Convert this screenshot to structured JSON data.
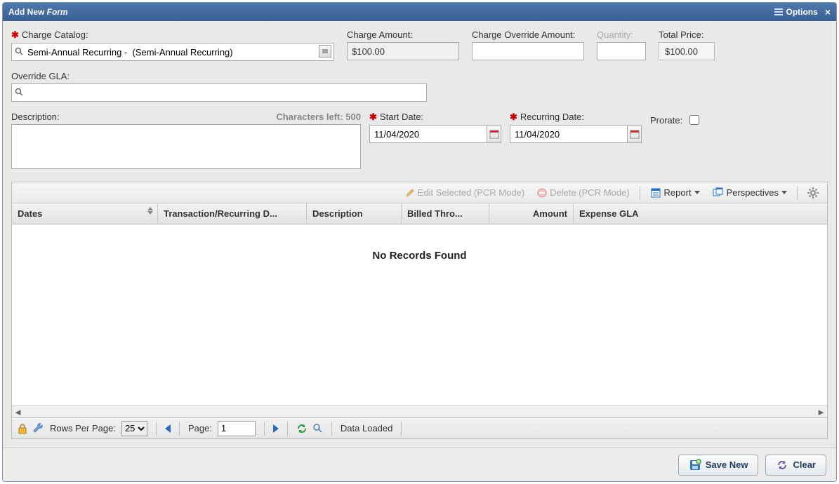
{
  "title": {
    "prefix": "Add New ",
    "suffix": "Form"
  },
  "options_label": "Options",
  "fields": {
    "charge_catalog": {
      "label": "Charge Catalog:",
      "value": "Semi-Annual Recurring -  (Semi-Annual Recurring)"
    },
    "charge_amount": {
      "label": "Charge Amount:",
      "value": "$100.00"
    },
    "charge_override": {
      "label": "Charge Override Amount:",
      "value": ""
    },
    "quantity": {
      "label": "Quantity:",
      "value": ""
    },
    "total_price": {
      "label": "Total Price:",
      "value": "$100.00"
    },
    "override_gla": {
      "label": "Override GLA:",
      "value": ""
    },
    "description": {
      "label": "Description:",
      "chars_left": "Characters left: 500",
      "value": ""
    },
    "start_date": {
      "label": "Start Date:",
      "value": "11/04/2020"
    },
    "recurring_date": {
      "label": "Recurring Date:",
      "value": "11/04/2020"
    },
    "prorate": {
      "label": "Prorate:",
      "checked": false
    }
  },
  "toolbar": {
    "edit_selected": "Edit Selected (PCR Mode)",
    "delete": "Delete (PCR Mode)",
    "report": "Report",
    "perspectives": "Perspectives"
  },
  "grid": {
    "columns": [
      "Dates",
      "Transaction/Recurring D...",
      "Description",
      "Billed Thro...",
      "Amount",
      "Expense GLA"
    ],
    "empty_text": "No Records Found"
  },
  "pager": {
    "rows_per_page_label": "Rows Per Page:",
    "rows_per_page_value": "25",
    "page_label": "Page:",
    "page_value": "1",
    "status": "Data Loaded"
  },
  "footer": {
    "save_new": "Save New",
    "clear": "Clear"
  }
}
